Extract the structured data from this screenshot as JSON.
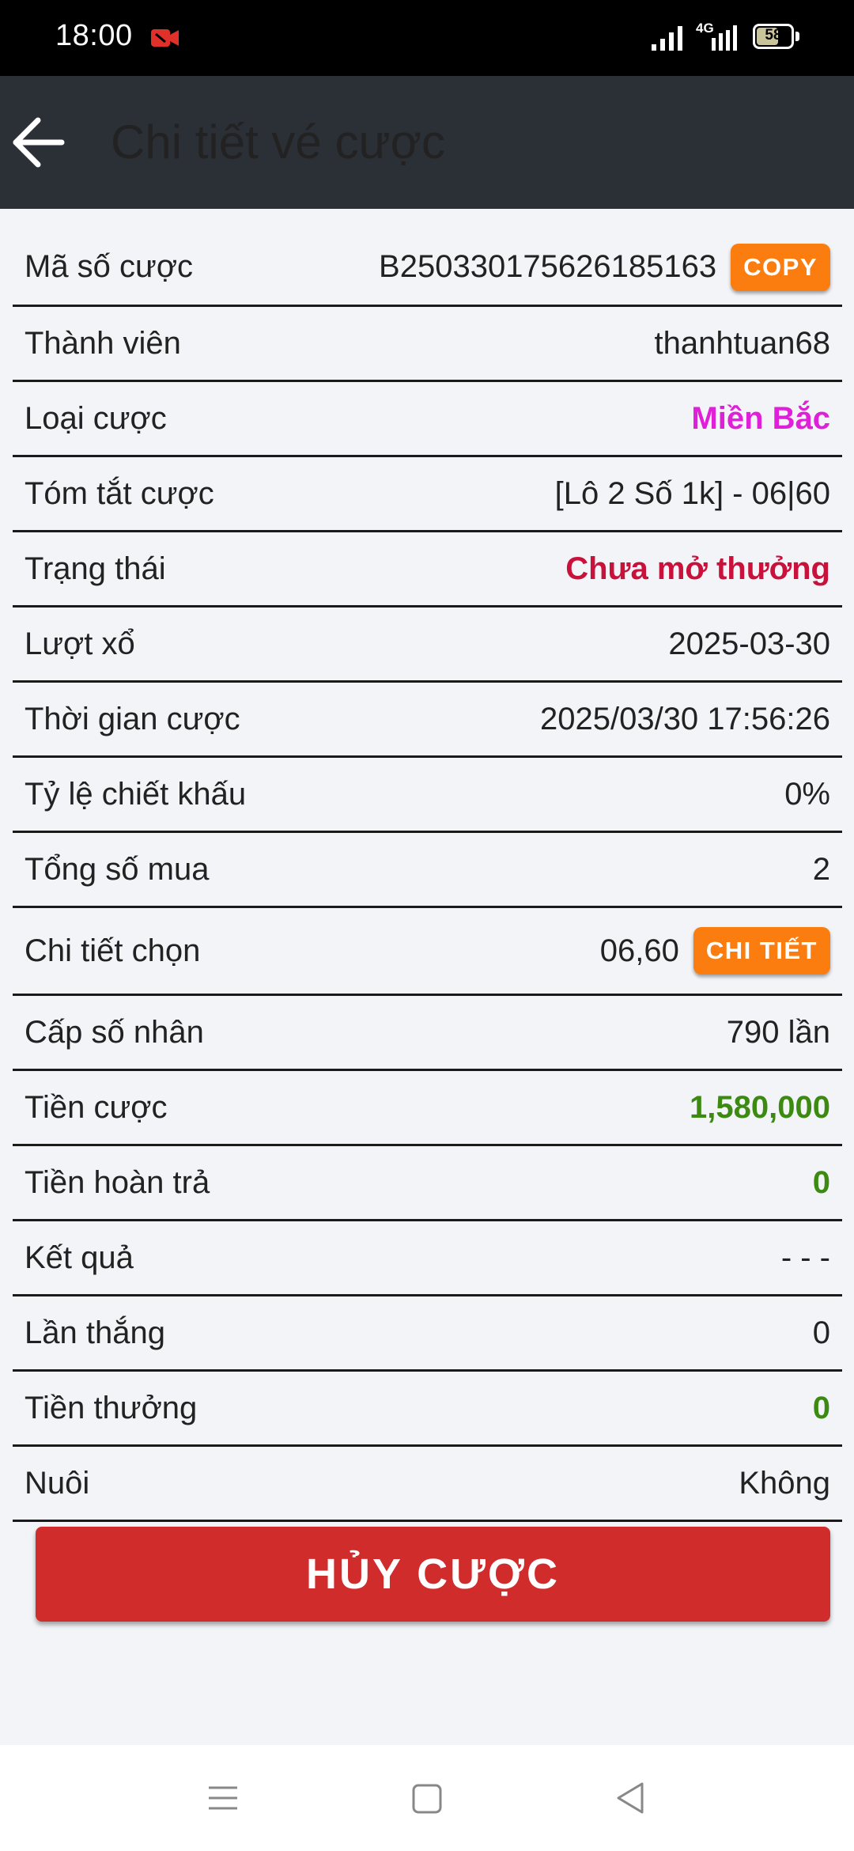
{
  "status_bar": {
    "time": "18:00",
    "network": "4G",
    "battery": "58",
    "icons": [
      "recording-icon",
      "signal-icon",
      "battery-icon"
    ],
    "rec_color": "#e0302a"
  },
  "header": {
    "title": "Chi tiết vé cược",
    "back_icon": "arrow-left-icon"
  },
  "rows": [
    {
      "label": "Mã số cược",
      "value": "B250330175626185163",
      "button": "COPY"
    },
    {
      "label": "Thành viên",
      "value": "thanhtuan68"
    },
    {
      "label": "Loại cược",
      "value": "Miền Bắc",
      "color": "#e020d8"
    },
    {
      "label": "Tóm tắt cược",
      "value": "[Lô 2 Số 1k] - 06|60"
    },
    {
      "label": "Trạng thái",
      "value": "Chưa mở thưởng",
      "color": "#c8123c"
    },
    {
      "label": "Lượt xổ",
      "value": "2025-03-30"
    },
    {
      "label": "Thời gian cược",
      "value": "2025/03/30 17:56:26"
    },
    {
      "label": "Tỷ lệ chiết khấu",
      "value": "0%"
    },
    {
      "label": "Tổng số mua",
      "value": "2"
    },
    {
      "label": "Chi tiết chọn",
      "value": "06,60",
      "button": "CHI TIẾT"
    },
    {
      "label": "Cấp số nhân",
      "value": "790 lần"
    },
    {
      "label": "Tiền cược",
      "value": "1,580,000",
      "color": "#3c8a12"
    },
    {
      "label": "Tiền hoàn trả",
      "value": "0",
      "color": "#3c8a12"
    },
    {
      "label": "Kết quả",
      "value": "- - -"
    },
    {
      "label": "Lần thắng",
      "value": "0"
    },
    {
      "label": "Tiền thưởng",
      "value": "0",
      "color": "#3c8a12"
    },
    {
      "label": "Nuôi",
      "value": "Không"
    }
  ],
  "cancel_button": "HỦY CƯỢC",
  "colors": {
    "app_bar": "#2b2f36",
    "accent_orange": "#fb7d0f",
    "cancel_red": "#d12c2c",
    "background": "#f3f4f8"
  },
  "nav_bar": {
    "icons": [
      "menu-icon",
      "home-square-icon",
      "back-triangle-icon"
    ]
  }
}
